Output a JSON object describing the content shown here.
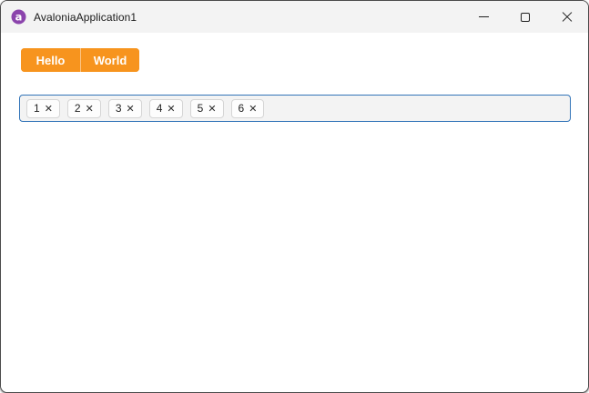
{
  "window": {
    "title": "AvaloniaApplication1",
    "logo_letter": "a",
    "controls": [
      {
        "icon": "minimize-icon"
      },
      {
        "icon": "maximize-icon"
      },
      {
        "icon": "close-icon"
      }
    ]
  },
  "tab_bar": {
    "items": [
      {
        "label": "Hello"
      },
      {
        "label": "World"
      }
    ]
  },
  "chip_input": {
    "remove_glyph": "✕",
    "chips": [
      {
        "label": "1"
      },
      {
        "label": "2"
      },
      {
        "label": "3"
      },
      {
        "label": "4"
      },
      {
        "label": "5"
      },
      {
        "label": "6"
      }
    ]
  },
  "colors": {
    "accent_orange": "#F7941E",
    "focus_border_blue": "#3274B8",
    "titlebar_bg": "#F3F3F3",
    "logo_purple": "#8B44AC",
    "chip_bg": "#FDFDFD",
    "chip_border": "#D5D5D5",
    "field_bg": "#F3F3F3"
  }
}
